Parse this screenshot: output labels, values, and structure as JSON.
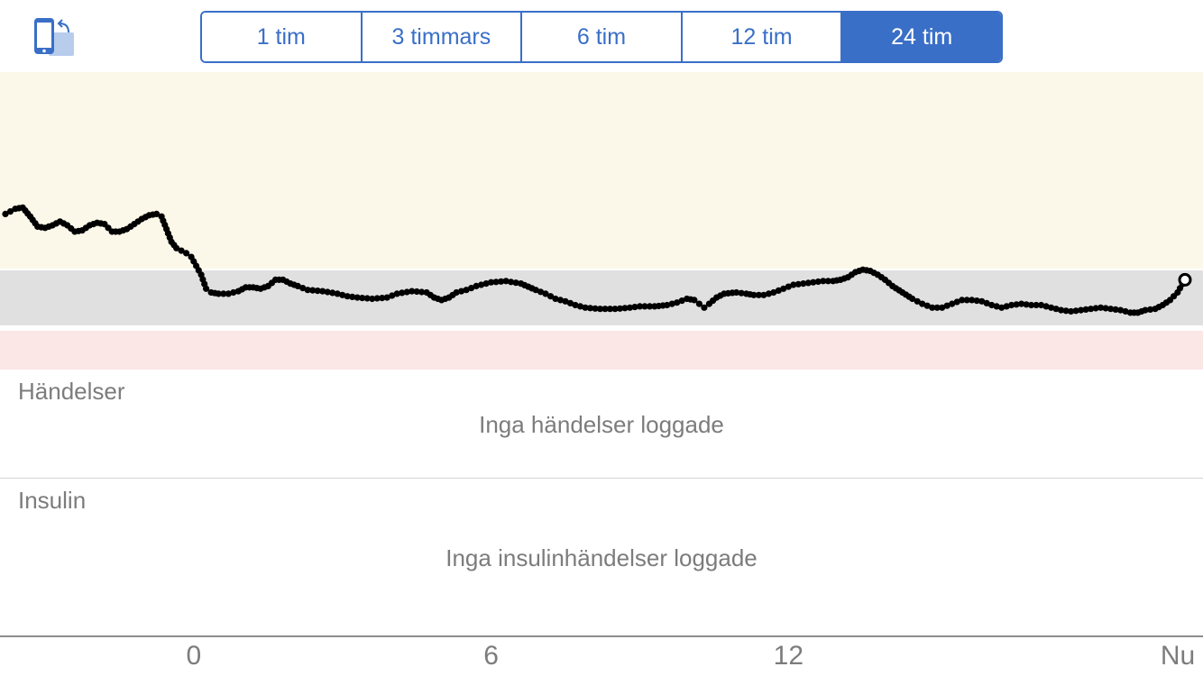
{
  "toolbar": {
    "rotate_icon": "rotate-device-icon",
    "accent_color": "#3a6fc7",
    "ranges": [
      {
        "label": "1 tim",
        "active": false
      },
      {
        "label": "3 timmars",
        "active": false
      },
      {
        "label": "6 tim",
        "active": false
      },
      {
        "label": "12 tim",
        "active": false
      },
      {
        "label": "24 tim",
        "active": true
      }
    ]
  },
  "chart_data": {
    "type": "scatter",
    "x_unit": "hours relative to midnight",
    "xlim": [
      -3.8,
      20
    ],
    "x_ticks": [
      {
        "value": 0,
        "label": "0"
      },
      {
        "value": 6,
        "label": "6"
      },
      {
        "value": 12,
        "label": "12"
      },
      {
        "value": 20,
        "label": "Nu"
      }
    ],
    "y_scale": "relative 0-1",
    "bands": [
      {
        "name": "high",
        "from": 0.215,
        "to": 1.0,
        "color": "#fcf8e9"
      },
      {
        "name": "target",
        "from": 0.0,
        "to": 0.188,
        "color": "#e0e0e0"
      },
      {
        "name": "low",
        "from": -0.2,
        "to": -0.02,
        "color": "#fbe7e6"
      }
    ],
    "series": [
      {
        "current_point_style": "open-circle",
        "points": [
          [
            -3.8,
            0.44
          ],
          [
            -3.6,
            0.46
          ],
          [
            -3.45,
            0.465
          ],
          [
            -3.3,
            0.43
          ],
          [
            -3.15,
            0.39
          ],
          [
            -3.0,
            0.385
          ],
          [
            -2.85,
            0.395
          ],
          [
            -2.7,
            0.41
          ],
          [
            -2.55,
            0.395
          ],
          [
            -2.4,
            0.37
          ],
          [
            -2.25,
            0.375
          ],
          [
            -2.1,
            0.395
          ],
          [
            -1.95,
            0.405
          ],
          [
            -1.8,
            0.4
          ],
          [
            -1.65,
            0.37
          ],
          [
            -1.5,
            0.37
          ],
          [
            -1.35,
            0.38
          ],
          [
            -1.2,
            0.4
          ],
          [
            -1.05,
            0.42
          ],
          [
            -0.9,
            0.435
          ],
          [
            -0.75,
            0.44
          ],
          [
            -0.65,
            0.43
          ],
          [
            -0.55,
            0.38
          ],
          [
            -0.45,
            0.33
          ],
          [
            -0.35,
            0.305
          ],
          [
            -0.25,
            0.295
          ],
          [
            -0.15,
            0.285
          ],
          [
            -0.05,
            0.27
          ],
          [
            0.05,
            0.235
          ],
          [
            0.15,
            0.2
          ],
          [
            0.25,
            0.145
          ],
          [
            0.35,
            0.13
          ],
          [
            0.5,
            0.125
          ],
          [
            0.7,
            0.125
          ],
          [
            0.9,
            0.135
          ],
          [
            1.05,
            0.15
          ],
          [
            1.2,
            0.15
          ],
          [
            1.35,
            0.145
          ],
          [
            1.5,
            0.155
          ],
          [
            1.65,
            0.18
          ],
          [
            1.8,
            0.18
          ],
          [
            1.95,
            0.165
          ],
          [
            2.1,
            0.155
          ],
          [
            2.3,
            0.14
          ],
          [
            2.6,
            0.135
          ],
          [
            2.9,
            0.125
          ],
          [
            3.1,
            0.115
          ],
          [
            3.3,
            0.11
          ],
          [
            3.6,
            0.105
          ],
          [
            3.9,
            0.11
          ],
          [
            4.1,
            0.125
          ],
          [
            4.4,
            0.135
          ],
          [
            4.7,
            0.13
          ],
          [
            4.85,
            0.11
          ],
          [
            5.0,
            0.1
          ],
          [
            5.15,
            0.11
          ],
          [
            5.3,
            0.13
          ],
          [
            5.5,
            0.14
          ],
          [
            5.7,
            0.155
          ],
          [
            6.0,
            0.17
          ],
          [
            6.3,
            0.175
          ],
          [
            6.6,
            0.165
          ],
          [
            6.9,
            0.14
          ],
          [
            7.1,
            0.125
          ],
          [
            7.3,
            0.105
          ],
          [
            7.5,
            0.095
          ],
          [
            7.7,
            0.08
          ],
          [
            7.9,
            0.07
          ],
          [
            8.2,
            0.065
          ],
          [
            8.5,
            0.065
          ],
          [
            8.8,
            0.07
          ],
          [
            9.0,
            0.075
          ],
          [
            9.3,
            0.075
          ],
          [
            9.55,
            0.08
          ],
          [
            9.75,
            0.09
          ],
          [
            9.95,
            0.105
          ],
          [
            10.1,
            0.1
          ],
          [
            10.2,
            0.085
          ],
          [
            10.3,
            0.07
          ],
          [
            10.4,
            0.085
          ],
          [
            10.55,
            0.11
          ],
          [
            10.7,
            0.125
          ],
          [
            10.95,
            0.13
          ],
          [
            11.15,
            0.125
          ],
          [
            11.3,
            0.12
          ],
          [
            11.5,
            0.12
          ],
          [
            11.7,
            0.13
          ],
          [
            11.9,
            0.145
          ],
          [
            12.1,
            0.16
          ],
          [
            12.3,
            0.165
          ],
          [
            12.5,
            0.17
          ],
          [
            12.7,
            0.175
          ],
          [
            12.9,
            0.175
          ],
          [
            13.05,
            0.18
          ],
          [
            13.2,
            0.19
          ],
          [
            13.35,
            0.21
          ],
          [
            13.5,
            0.22
          ],
          [
            13.65,
            0.215
          ],
          [
            13.8,
            0.2
          ],
          [
            13.95,
            0.18
          ],
          [
            14.1,
            0.155
          ],
          [
            14.3,
            0.13
          ],
          [
            14.5,
            0.105
          ],
          [
            14.7,
            0.085
          ],
          [
            14.9,
            0.07
          ],
          [
            15.1,
            0.07
          ],
          [
            15.3,
            0.085
          ],
          [
            15.5,
            0.1
          ],
          [
            15.7,
            0.1
          ],
          [
            15.9,
            0.095
          ],
          [
            16.1,
            0.08
          ],
          [
            16.3,
            0.07
          ],
          [
            16.5,
            0.08
          ],
          [
            16.7,
            0.085
          ],
          [
            16.9,
            0.08
          ],
          [
            17.1,
            0.08
          ],
          [
            17.3,
            0.07
          ],
          [
            17.5,
            0.06
          ],
          [
            17.7,
            0.055
          ],
          [
            17.9,
            0.06
          ],
          [
            18.1,
            0.065
          ],
          [
            18.3,
            0.07
          ],
          [
            18.5,
            0.065
          ],
          [
            18.7,
            0.06
          ],
          [
            18.9,
            0.05
          ],
          [
            19.05,
            0.05
          ],
          [
            19.2,
            0.06
          ],
          [
            19.4,
            0.065
          ],
          [
            19.55,
            0.08
          ],
          [
            19.7,
            0.1
          ],
          [
            19.85,
            0.13
          ],
          [
            20.0,
            0.18
          ]
        ]
      }
    ]
  },
  "events": {
    "title": "Händelser",
    "empty": "Inga händelser loggade"
  },
  "insulin": {
    "title": "Insulin",
    "empty": "Inga insulinhändelser loggade"
  }
}
